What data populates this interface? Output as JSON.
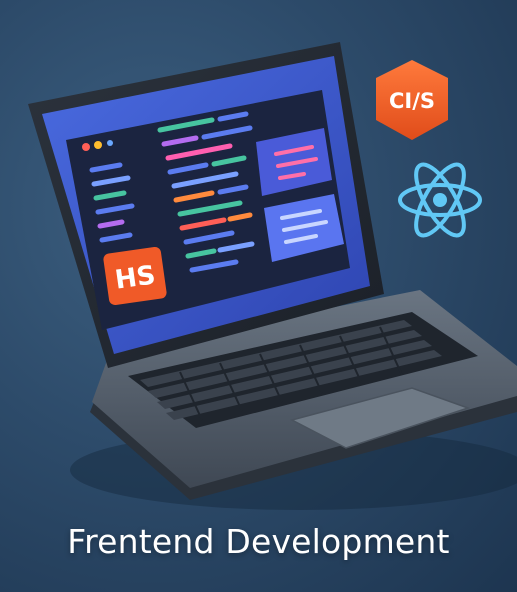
{
  "caption": "Frentend Development",
  "badges": {
    "hs_label": "HS",
    "cis_label": "CI/S"
  },
  "colors": {
    "background": "#2d4b6a",
    "screen": "#3b57c9",
    "editor": "#1b2440",
    "orange_badge": "#f05a28",
    "react_blue": "#61c8f5",
    "laptop_body": "#5b6673"
  },
  "icons": [
    "laptop-icon",
    "cis-badge-icon",
    "react-atom-icon",
    "hs-badge-icon"
  ]
}
